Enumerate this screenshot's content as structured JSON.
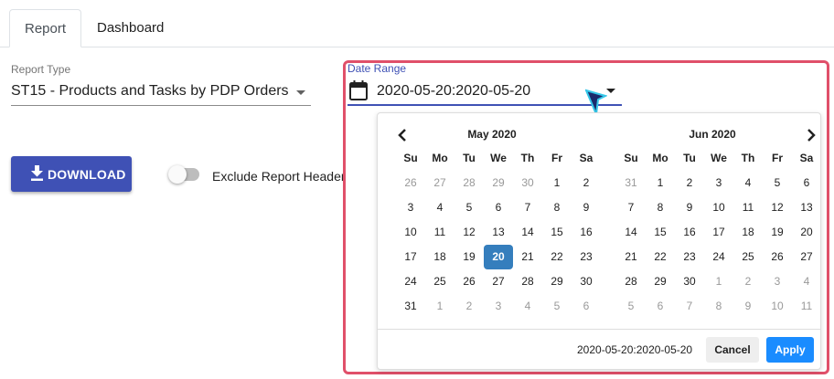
{
  "tabs": [
    {
      "label": "Report",
      "active": true
    },
    {
      "label": "Dashboard",
      "active": false
    }
  ],
  "report_type": {
    "label": "Report Type",
    "value": "ST15 - Products and Tasks by PDP Orders"
  },
  "download_button": {
    "label": "DOWNLOAD",
    "icon": "download-icon"
  },
  "exclude_header": {
    "label": "Exclude Report Header",
    "checked": false
  },
  "date_range": {
    "label": "Date Range",
    "value": "2020-05-20:2020-05-20",
    "icon": "calendar-icon"
  },
  "calendar": {
    "weekdays": [
      "Su",
      "Mo",
      "Tu",
      "We",
      "Th",
      "Fr",
      "Sa"
    ],
    "months": [
      {
        "title": "May 2020",
        "weeks": [
          [
            {
              "d": "26",
              "off": true
            },
            {
              "d": "27",
              "off": true
            },
            {
              "d": "28",
              "off": true
            },
            {
              "d": "29",
              "off": true
            },
            {
              "d": "30",
              "off": true
            },
            {
              "d": "1"
            },
            {
              "d": "2"
            }
          ],
          [
            {
              "d": "3"
            },
            {
              "d": "4"
            },
            {
              "d": "5"
            },
            {
              "d": "6"
            },
            {
              "d": "7"
            },
            {
              "d": "8"
            },
            {
              "d": "9"
            }
          ],
          [
            {
              "d": "10"
            },
            {
              "d": "11"
            },
            {
              "d": "12"
            },
            {
              "d": "13"
            },
            {
              "d": "14"
            },
            {
              "d": "15"
            },
            {
              "d": "16"
            }
          ],
          [
            {
              "d": "17"
            },
            {
              "d": "18"
            },
            {
              "d": "19"
            },
            {
              "d": "20",
              "sel": true
            },
            {
              "d": "21"
            },
            {
              "d": "22"
            },
            {
              "d": "23"
            }
          ],
          [
            {
              "d": "24"
            },
            {
              "d": "25"
            },
            {
              "d": "26"
            },
            {
              "d": "27"
            },
            {
              "d": "28"
            },
            {
              "d": "29"
            },
            {
              "d": "30"
            }
          ],
          [
            {
              "d": "31"
            },
            {
              "d": "1",
              "off": true
            },
            {
              "d": "2",
              "off": true
            },
            {
              "d": "3",
              "off": true
            },
            {
              "d": "4",
              "off": true
            },
            {
              "d": "5",
              "off": true
            },
            {
              "d": "6",
              "off": true
            }
          ]
        ]
      },
      {
        "title": "Jun 2020",
        "weeks": [
          [
            {
              "d": "31",
              "off": true
            },
            {
              "d": "1"
            },
            {
              "d": "2"
            },
            {
              "d": "3"
            },
            {
              "d": "4"
            },
            {
              "d": "5"
            },
            {
              "d": "6"
            }
          ],
          [
            {
              "d": "7"
            },
            {
              "d": "8"
            },
            {
              "d": "9"
            },
            {
              "d": "10"
            },
            {
              "d": "11"
            },
            {
              "d": "12"
            },
            {
              "d": "13"
            }
          ],
          [
            {
              "d": "14"
            },
            {
              "d": "15"
            },
            {
              "d": "16"
            },
            {
              "d": "17"
            },
            {
              "d": "18"
            },
            {
              "d": "19"
            },
            {
              "d": "20"
            }
          ],
          [
            {
              "d": "21"
            },
            {
              "d": "22"
            },
            {
              "d": "23"
            },
            {
              "d": "24"
            },
            {
              "d": "25"
            },
            {
              "d": "26"
            },
            {
              "d": "27"
            }
          ],
          [
            {
              "d": "28"
            },
            {
              "d": "29"
            },
            {
              "d": "30"
            },
            {
              "d": "1",
              "off": true
            },
            {
              "d": "2",
              "off": true
            },
            {
              "d": "3",
              "off": true
            },
            {
              "d": "4",
              "off": true
            }
          ],
          [
            {
              "d": "5",
              "off": true
            },
            {
              "d": "6",
              "off": true
            },
            {
              "d": "7",
              "off": true
            },
            {
              "d": "8",
              "off": true
            },
            {
              "d": "9",
              "off": true
            },
            {
              "d": "10",
              "off": true
            },
            {
              "d": "11",
              "off": true
            }
          ]
        ]
      }
    ],
    "footer_range": "2020-05-20:2020-05-20",
    "cancel_label": "Cancel",
    "apply_label": "Apply"
  },
  "colors": {
    "primary": "#3f51b5",
    "selected_day": "#357ebd",
    "apply": "#1a8cff",
    "highlight": "#e0506a"
  }
}
